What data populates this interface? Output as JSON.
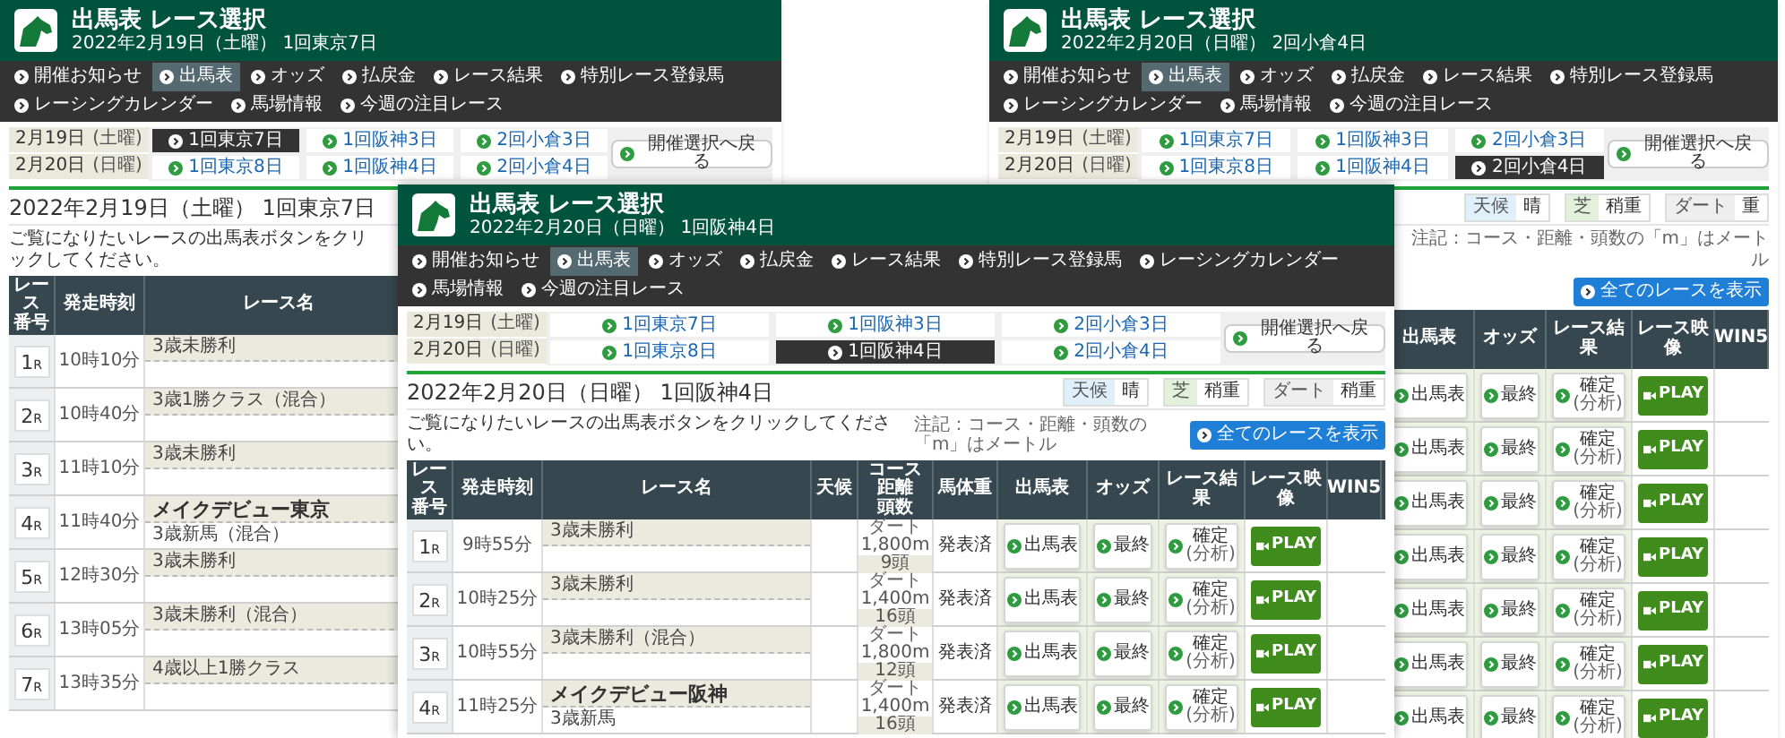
{
  "back_left_window": {
    "title": "出馬表 レース選択",
    "subtitle": "2022年2月19日（土曜） 1回東京7日",
    "nav": [
      {
        "label": "開催お知らせ",
        "selected": false
      },
      {
        "label": "出馬表",
        "selected": true
      },
      {
        "label": "オッズ",
        "selected": false
      },
      {
        "label": "払戻金",
        "selected": false
      },
      {
        "label": "レース結果",
        "selected": false
      },
      {
        "label": "特別レース登録馬",
        "selected": false
      },
      {
        "label": "レーシングカレンダー",
        "selected": false
      },
      {
        "label": "馬場情報",
        "selected": false
      },
      {
        "label": "今週の注目レース",
        "selected": false
      }
    ],
    "dates": [
      {
        "date": "2月19日",
        "weekday": "(土曜)",
        "meetings": [
          {
            "label": "1回東京7日",
            "selected": true
          },
          {
            "label": "1回阪神3日",
            "selected": false
          },
          {
            "label": "2回小倉3日",
            "selected": false
          }
        ]
      },
      {
        "date": "2月20日",
        "weekday": "(日曜)",
        "meetings": [
          {
            "label": "1回東京8日",
            "selected": false
          },
          {
            "label": "1回阪神4日",
            "selected": false
          },
          {
            "label": "2回小倉4日",
            "selected": false
          }
        ]
      }
    ],
    "back_button": "開催選択へ戻る",
    "heading": "2022年2月19日（土曜） 1回東京7日",
    "instruction": "ご覧になりたいレースの出馬表ボタンをクリックしてください。",
    "table": {
      "columns": [
        {
          "kind": "number",
          "lines": [
            "レース",
            "番号"
          ]
        },
        {
          "kind": "time",
          "lines": [
            "発走時刻"
          ]
        },
        {
          "kind": "name",
          "lines": [
            "レース名"
          ]
        }
      ],
      "rows": [
        {
          "race_no": "1",
          "race_suffix": "R",
          "time": "10時10分",
          "class": "3歳未勝利"
        },
        {
          "race_no": "2",
          "race_suffix": "R",
          "time": "10時40分",
          "class": "3歳1勝クラス（混合）"
        },
        {
          "race_no": "3",
          "race_suffix": "R",
          "time": "11時10分",
          "class": "3歳未勝利"
        },
        {
          "race_no": "4",
          "race_suffix": "R",
          "time": "11時40分",
          "title": "メイクデビュー東京",
          "class": "3歳新馬（混合）"
        },
        {
          "race_no": "5",
          "race_suffix": "R",
          "time": "12時30分",
          "class": "3歳未勝利"
        },
        {
          "race_no": "6",
          "race_suffix": "R",
          "time": "13時05分",
          "class": "3歳未勝利（混合）"
        },
        {
          "race_no": "7",
          "race_suffix": "R",
          "time": "13時35分",
          "class": "4歳以上1勝クラス"
        }
      ]
    }
  },
  "back_right_window": {
    "title": "出馬表 レース選択",
    "subtitle": "2022年2月20日（日曜） 2回小倉4日",
    "nav": [
      {
        "label": "開催お知らせ",
        "selected": false
      },
      {
        "label": "出馬表",
        "selected": true
      },
      {
        "label": "オッズ",
        "selected": false
      },
      {
        "label": "払戻金",
        "selected": false
      },
      {
        "label": "レース結果",
        "selected": false
      },
      {
        "label": "特別レース登録馬",
        "selected": false
      },
      {
        "label": "レーシングカレンダー",
        "selected": false
      },
      {
        "label": "馬場情報",
        "selected": false
      },
      {
        "label": "今週の注目レース",
        "selected": false
      }
    ],
    "dates": [
      {
        "date": "2月19日",
        "weekday": "(土曜)",
        "meetings": [
          {
            "label": "1回東京7日",
            "selected": false
          },
          {
            "label": "1回阪神3日",
            "selected": false
          },
          {
            "label": "2回小倉3日",
            "selected": false
          }
        ]
      },
      {
        "date": "2月20日",
        "weekday": "(日曜)",
        "meetings": [
          {
            "label": "1回東京8日",
            "selected": false
          },
          {
            "label": "1回阪神4日",
            "selected": false
          },
          {
            "label": "2回小倉4日",
            "selected": true
          }
        ]
      }
    ],
    "back_button": "開催選択へ戻る",
    "weather": [
      {
        "kind": "weather",
        "label": "天候",
        "value": "晴"
      },
      {
        "kind": "turf",
        "label": "芝",
        "value": "稍重"
      },
      {
        "kind": "dirt",
        "label": "ダート",
        "value": "重"
      }
    ],
    "note": "注記：コース・距離・頭数の「m」はメートル",
    "all_races_button": "全てのレースを表示",
    "table": {
      "columns": [
        {
          "kind": "entries",
          "lines": [
            "出馬表"
          ]
        },
        {
          "kind": "odds",
          "lines": [
            "オッズ"
          ]
        },
        {
          "kind": "result",
          "lines": [
            "レース結果"
          ]
        },
        {
          "kind": "video",
          "lines": [
            "レース映像"
          ]
        },
        {
          "kind": "win5",
          "lines": [
            "WIN5"
          ]
        }
      ],
      "rows": [
        {
          "entries": "出馬表",
          "odds": "最終",
          "result": "確定",
          "result_note": "(分析)",
          "video": "PLAY"
        },
        {
          "entries": "出馬表",
          "odds": "最終",
          "result": "確定",
          "result_note": "(分析)",
          "video": "PLAY"
        },
        {
          "entries": "出馬表",
          "odds": "最終",
          "result": "確定",
          "result_note": "(分析)",
          "video": "PLAY"
        },
        {
          "entries": "出馬表",
          "odds": "最終",
          "result": "確定",
          "result_note": "(分析)",
          "video": "PLAY"
        },
        {
          "entries": "出馬表",
          "odds": "最終",
          "result": "確定",
          "result_note": "(分析)",
          "video": "PLAY"
        },
        {
          "entries": "出馬表",
          "odds": "最終",
          "result": "確定",
          "result_note": "(分析)",
          "video": "PLAY"
        },
        {
          "entries": "出馬表",
          "odds": "最終",
          "result": "確定",
          "result_note": "(分析)",
          "video": "PLAY"
        }
      ]
    }
  },
  "front_window": {
    "title": "出馬表 レース選択",
    "subtitle": "2022年2月20日（日曜） 1回阪神4日",
    "nav": [
      {
        "label": "開催お知らせ",
        "selected": false
      },
      {
        "label": "出馬表",
        "selected": true
      },
      {
        "label": "オッズ",
        "selected": false
      },
      {
        "label": "払戻金",
        "selected": false
      },
      {
        "label": "レース結果",
        "selected": false
      },
      {
        "label": "特別レース登録馬",
        "selected": false
      },
      {
        "label": "レーシングカレンダー",
        "selected": false
      },
      {
        "label": "馬場情報",
        "selected": false
      },
      {
        "label": "今週の注目レース",
        "selected": false
      }
    ],
    "dates": [
      {
        "date": "2月19日",
        "weekday": "(土曜)",
        "meetings": [
          {
            "label": "1回東京7日",
            "selected": false
          },
          {
            "label": "1回阪神3日",
            "selected": false
          },
          {
            "label": "2回小倉3日",
            "selected": false
          }
        ]
      },
      {
        "date": "2月20日",
        "weekday": "(日曜)",
        "meetings": [
          {
            "label": "1回東京8日",
            "selected": false
          },
          {
            "label": "1回阪神4日",
            "selected": true
          },
          {
            "label": "2回小倉4日",
            "selected": false
          }
        ]
      }
    ],
    "back_button": "開催選択へ戻る",
    "heading": "2022年2月20日（日曜） 1回阪神4日",
    "weather": [
      {
        "kind": "weather",
        "label": "天候",
        "value": "晴"
      },
      {
        "kind": "turf",
        "label": "芝",
        "value": "稍重"
      },
      {
        "kind": "dirt",
        "label": "ダート",
        "value": "稍重"
      }
    ],
    "instruction": "ご覧になりたいレースの出馬表ボタンをクリックしてください。",
    "note": "注記：コース・距離・頭数の「m」はメートル",
    "all_races_button": "全てのレースを表示",
    "table": {
      "columns": [
        {
          "kind": "number",
          "lines": [
            "レース",
            "番号"
          ]
        },
        {
          "kind": "time",
          "lines": [
            "発走時刻"
          ]
        },
        {
          "kind": "name",
          "lines": [
            "レース名"
          ]
        },
        {
          "kind": "weather",
          "lines": [
            "天候"
          ]
        },
        {
          "kind": "course",
          "lines": [
            "コース",
            "距離",
            "頭数"
          ]
        },
        {
          "kind": "weight",
          "lines": [
            "馬体重"
          ]
        },
        {
          "kind": "entries",
          "lines": [
            "出馬表"
          ]
        },
        {
          "kind": "odds",
          "lines": [
            "オッズ"
          ]
        },
        {
          "kind": "result",
          "lines": [
            "レース結果"
          ]
        },
        {
          "kind": "video",
          "lines": [
            "レース映像"
          ]
        },
        {
          "kind": "win5",
          "lines": [
            "WIN5"
          ]
        }
      ],
      "rows": [
        {
          "race_no": "1",
          "race_suffix": "R",
          "time": "9時55分",
          "class": "3歳未勝利",
          "surface": "ダート",
          "distance": "1,800m",
          "heads": "9頭",
          "weight": "発表済",
          "entries": "出馬表",
          "odds": "最終",
          "result": "確定",
          "result_note": "(分析)",
          "video": "PLAY"
        },
        {
          "race_no": "2",
          "race_suffix": "R",
          "time": "10時25分",
          "class": "3歳未勝利",
          "surface": "ダート",
          "distance": "1,400m",
          "heads": "16頭",
          "weight": "発表済",
          "entries": "出馬表",
          "odds": "最終",
          "result": "確定",
          "result_note": "(分析)",
          "video": "PLAY"
        },
        {
          "race_no": "3",
          "race_suffix": "R",
          "time": "10時55分",
          "class": "3歳未勝利（混合）",
          "surface": "ダート",
          "distance": "1,800m",
          "heads": "12頭",
          "weight": "発表済",
          "entries": "出馬表",
          "odds": "最終",
          "result": "確定",
          "result_note": "(分析)",
          "video": "PLAY"
        },
        {
          "race_no": "4",
          "race_suffix": "R",
          "time": "11時25分",
          "title": "メイクデビュー阪神",
          "class": "3歳新馬",
          "surface": "ダート",
          "distance": "1,400m",
          "heads": "16頭",
          "weight": "発表済",
          "entries": "出馬表",
          "odds": "最終",
          "result": "確定",
          "result_note": "(分析)",
          "video": "PLAY"
        }
      ]
    }
  }
}
